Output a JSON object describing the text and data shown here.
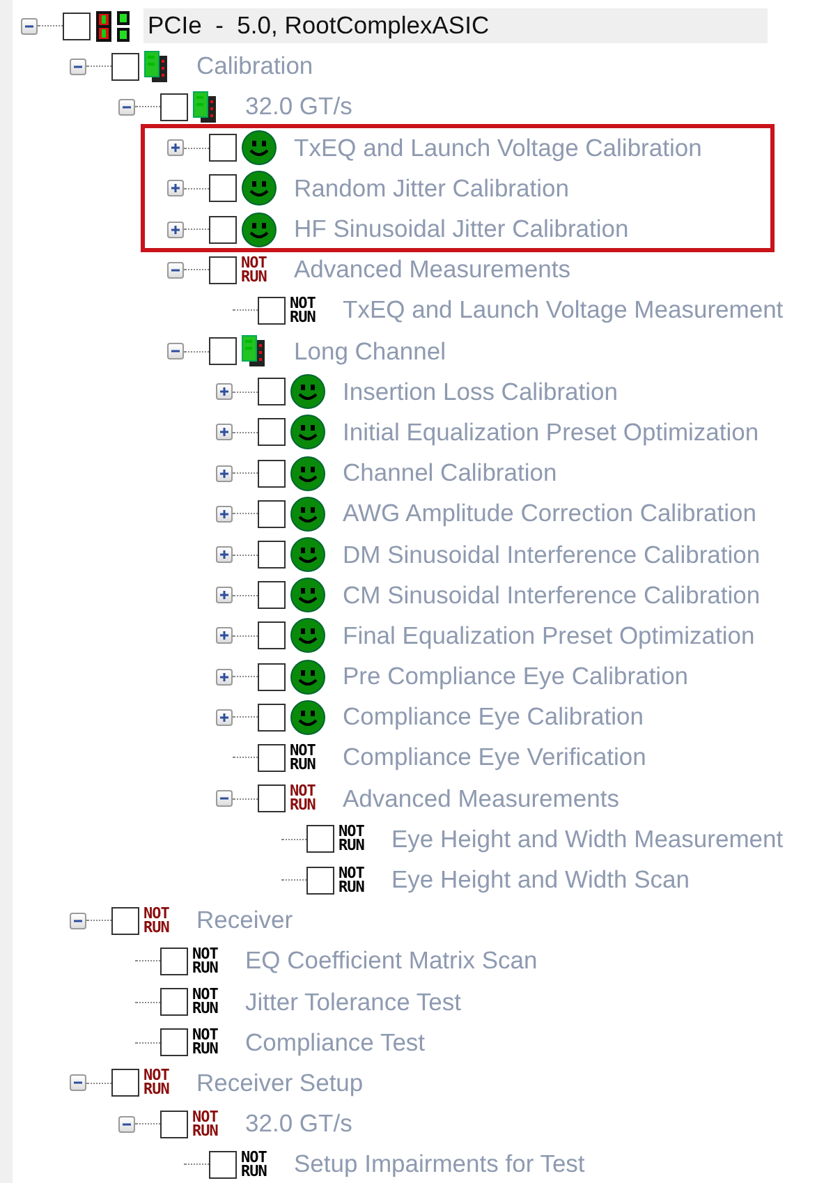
{
  "tree": [
    {
      "label": "PCIe  -  5.0, RootComplexASIC",
      "kind": "chips",
      "checked": false,
      "selected": true,
      "highlighted": false,
      "expanded": true,
      "children": [
        {
          "label": "Calibration",
          "kind": "module",
          "checked": false,
          "selected": false,
          "highlighted": false,
          "expanded": true,
          "children": [
            {
              "label": "32.0 GT/s",
              "kind": "module",
              "checked": false,
              "selected": false,
              "highlighted": false,
              "expanded": true,
              "children": [
                {
                  "label": "TxEQ and Launch Voltage Calibration",
                  "kind": "pass",
                  "checked": false,
                  "selected": false,
                  "highlighted": true,
                  "expanded": false
                },
                {
                  "label": "Random Jitter Calibration",
                  "kind": "pass",
                  "checked": false,
                  "selected": false,
                  "highlighted": true,
                  "expanded": false
                },
                {
                  "label": "HF Sinusoidal Jitter Calibration",
                  "kind": "pass",
                  "checked": false,
                  "selected": false,
                  "highlighted": true,
                  "expanded": false
                },
                {
                  "label": "Advanced Measurements",
                  "kind": "not_run",
                  "status_text": "NOT RUN",
                  "color": "#8b0d0d",
                  "checked": false,
                  "selected": false,
                  "highlighted": false,
                  "expanded": true,
                  "children": [
                    {
                      "label": "TxEQ and Launch Voltage Measurement",
                      "kind": "not_run",
                      "status_text": "NOT RUN",
                      "color": "#000000",
                      "checked": false,
                      "selected": false,
                      "highlighted": false
                    }
                  ]
                },
                {
                  "label": "Long Channel",
                  "kind": "module",
                  "checked": false,
                  "selected": false,
                  "highlighted": false,
                  "expanded": true,
                  "children": [
                    {
                      "label": "Insertion Loss Calibration",
                      "kind": "pass",
                      "checked": false,
                      "selected": false,
                      "highlighted": false,
                      "expanded": false
                    },
                    {
                      "label": "Initial Equalization Preset Optimization",
                      "kind": "pass",
                      "checked": false,
                      "selected": false,
                      "highlighted": false,
                      "expanded": false
                    },
                    {
                      "label": "Channel Calibration",
                      "kind": "pass",
                      "checked": false,
                      "selected": false,
                      "highlighted": false,
                      "expanded": false
                    },
                    {
                      "label": "AWG Amplitude Correction Calibration",
                      "kind": "pass",
                      "checked": false,
                      "selected": false,
                      "highlighted": false,
                      "expanded": false
                    },
                    {
                      "label": "DM Sinusoidal Interference Calibration",
                      "kind": "pass",
                      "checked": false,
                      "selected": false,
                      "highlighted": false,
                      "expanded": false
                    },
                    {
                      "label": "CM Sinusoidal Interference Calibration",
                      "kind": "pass",
                      "checked": false,
                      "selected": false,
                      "highlighted": false,
                      "expanded": false
                    },
                    {
                      "label": "Final Equalization Preset Optimization",
                      "kind": "pass",
                      "checked": false,
                      "selected": false,
                      "highlighted": false,
                      "expanded": false
                    },
                    {
                      "label": "Pre Compliance Eye Calibration",
                      "kind": "pass",
                      "checked": false,
                      "selected": false,
                      "highlighted": false,
                      "expanded": false
                    },
                    {
                      "label": "Compliance Eye Calibration",
                      "kind": "pass",
                      "checked": false,
                      "selected": false,
                      "highlighted": false,
                      "expanded": false
                    },
                    {
                      "label": "Compliance Eye Verification",
                      "kind": "not_run",
                      "status_text": "NOT RUN",
                      "color": "#000000",
                      "checked": false,
                      "selected": false,
                      "highlighted": false
                    },
                    {
                      "label": "Advanced Measurements",
                      "kind": "not_run",
                      "status_text": "NOT RUN",
                      "color": "#8b0d0d",
                      "checked": false,
                      "selected": false,
                      "highlighted": false,
                      "expanded": true,
                      "children": [
                        {
                          "label": "Eye Height and Width Measurement",
                          "kind": "not_run",
                          "status_text": "NOT RUN",
                          "color": "#000000",
                          "checked": false,
                          "selected": false,
                          "highlighted": false
                        },
                        {
                          "label": "Eye Height and Width Scan",
                          "kind": "not_run",
                          "status_text": "NOT RUN",
                          "color": "#000000",
                          "checked": false,
                          "selected": false,
                          "highlighted": false
                        }
                      ]
                    }
                  ]
                }
              ]
            }
          ]
        },
        {
          "label": "Receiver",
          "kind": "not_run",
          "status_text": "NOT RUN",
          "color": "#8b0d0d",
          "checked": false,
          "selected": false,
          "highlighted": false,
          "expanded": true,
          "children": [
            {
              "label": "EQ Coefficient Matrix Scan",
              "kind": "not_run",
              "status_text": "NOT RUN",
              "color": "#000000",
              "checked": false,
              "selected": false,
              "highlighted": false
            },
            {
              "label": "Jitter Tolerance Test",
              "kind": "not_run",
              "status_text": "NOT RUN",
              "color": "#000000",
              "checked": false,
              "selected": false,
              "highlighted": false
            },
            {
              "label": "Compliance Test",
              "kind": "not_run",
              "status_text": "NOT RUN",
              "color": "#000000",
              "checked": false,
              "selected": false,
              "highlighted": false
            }
          ]
        },
        {
          "label": "Receiver Setup",
          "kind": "not_run",
          "status_text": "NOT RUN",
          "color": "#8b0d0d",
          "checked": false,
          "selected": false,
          "highlighted": false,
          "expanded": true,
          "children": [
            {
              "label": "32.0 GT/s",
              "kind": "not_run",
              "status_text": "NOT RUN",
              "color": "#8b0d0d",
              "checked": false,
              "selected": false,
              "highlighted": false,
              "expanded": true,
              "children": [
                {
                  "label": "Setup Impairments for Test",
                  "kind": "not_run",
                  "status_text": "NOT RUN",
                  "color": "#000000",
                  "checked": false,
                  "selected": false,
                  "highlighted": false
                }
              ]
            }
          ]
        }
      ]
    }
  ]
}
